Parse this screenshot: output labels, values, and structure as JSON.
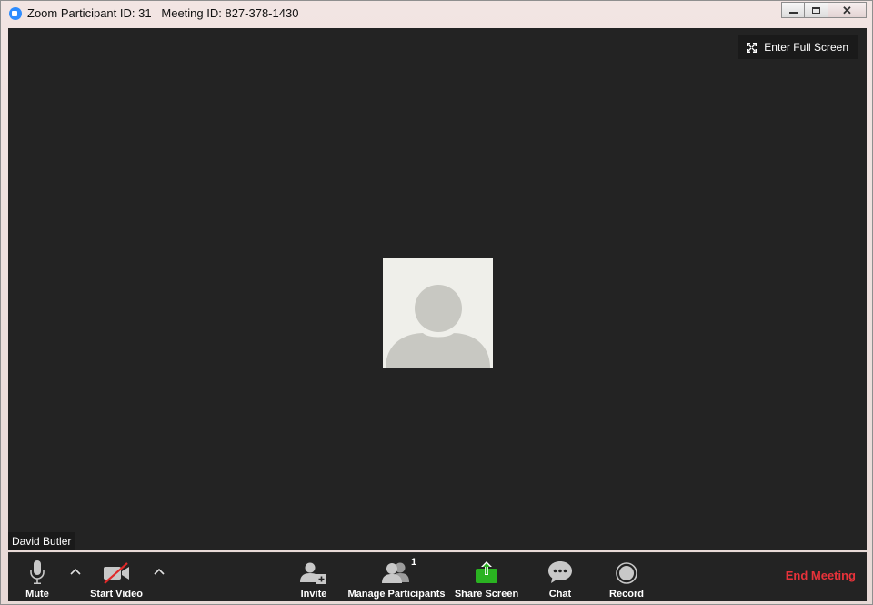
{
  "window": {
    "title": "Zoom Participant ID: 31   Meeting ID: 827-378-1430",
    "controls": {
      "minimize": "minimize-icon",
      "maximize": "maximize-icon",
      "close": "close-icon"
    }
  },
  "video": {
    "fullscreen_label": "Enter Full Screen",
    "participant_name": "David Butler"
  },
  "toolbar": {
    "mute": "Mute",
    "start_video": "Start Video",
    "invite": "Invite",
    "manage_participants": "Manage Participants",
    "participant_count": "1",
    "share_screen": "Share Screen",
    "chat": "Chat",
    "record": "Record",
    "end_meeting": "End Meeting"
  },
  "colors": {
    "stage": "#232323",
    "share_green": "#2ab321",
    "end_red": "#e8323a",
    "icon_grey": "#c8c8c8"
  }
}
